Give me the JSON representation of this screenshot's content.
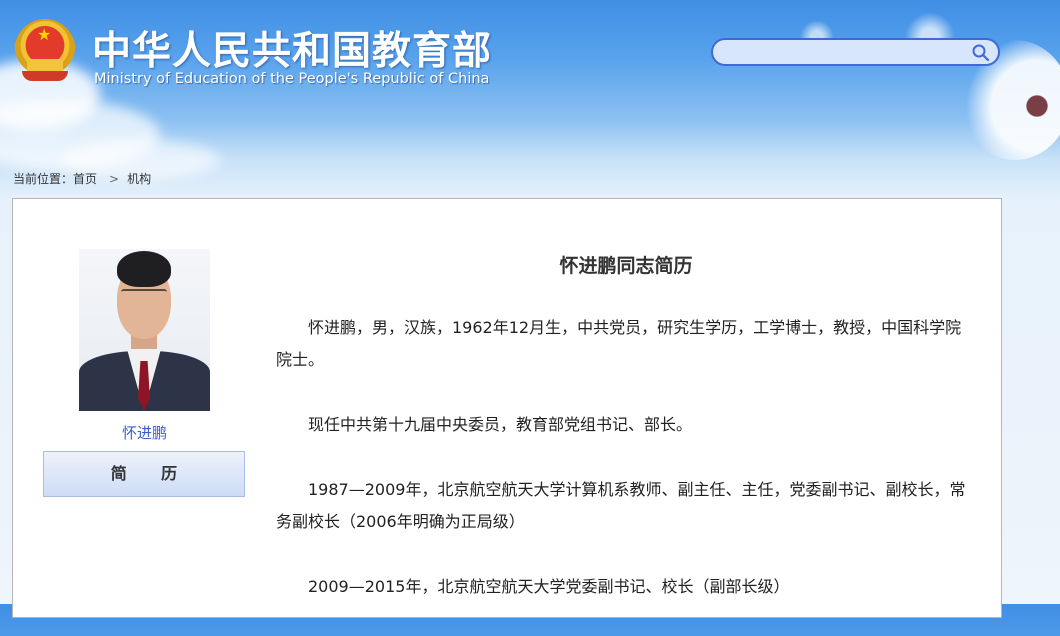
{
  "header": {
    "site_title": "中华人民共和国教育部",
    "site_subtitle": "Ministry of Education of the People's Republic of China",
    "emblem_icon": "national-emblem-icon"
  },
  "search": {
    "placeholder": "",
    "value": "",
    "icon": "search-icon"
  },
  "breadcrumb": {
    "prefix": "当前位置：",
    "home": "首页",
    "separator": ">",
    "current": "机构"
  },
  "profile": {
    "name": "怀进鹏",
    "tab_label": "简 历",
    "photo_icon": "portrait-photo"
  },
  "article": {
    "title": "怀进鹏同志简历",
    "paragraphs": [
      "怀进鹏，男，汉族，1962年12月生，中共党员，研究生学历，工学博士，教授，中国科学院院士。",
      "现任中共第十九届中央委员，教育部党组书记、部长。",
      "1987—2009年，北京航空航天大学计算机系教师、副主任、主任，党委副书记、副校长，常务副校长（2006年明确为正局级）",
      "2009—2015年，北京航空航天大学党委副书记、校长（副部长级）"
    ]
  },
  "colors": {
    "sky_top": "#3f8fe6",
    "accent_blue": "#3f69d4",
    "name_link": "#3a5fcd",
    "panel_border": "#b5b5b5"
  }
}
